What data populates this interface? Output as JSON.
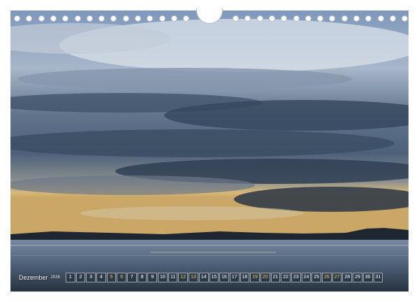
{
  "calendar": {
    "month": "Dezember",
    "year": "2026",
    "days": [
      "1",
      "2",
      "3",
      "4",
      "5",
      "6",
      "7",
      "8",
      "9",
      "10",
      "11",
      "12",
      "13",
      "14",
      "15",
      "16",
      "17",
      "18",
      "19",
      "20",
      "21",
      "22",
      "23",
      "24",
      "25",
      "26",
      "27",
      "28",
      "29",
      "30",
      "31"
    ],
    "weekend_days": [
      "5",
      "6",
      "12",
      "13",
      "19",
      "20",
      "26",
      "27"
    ]
  },
  "colors": {
    "weekend": "#f0c24a",
    "regular_day": "#ffffff"
  }
}
